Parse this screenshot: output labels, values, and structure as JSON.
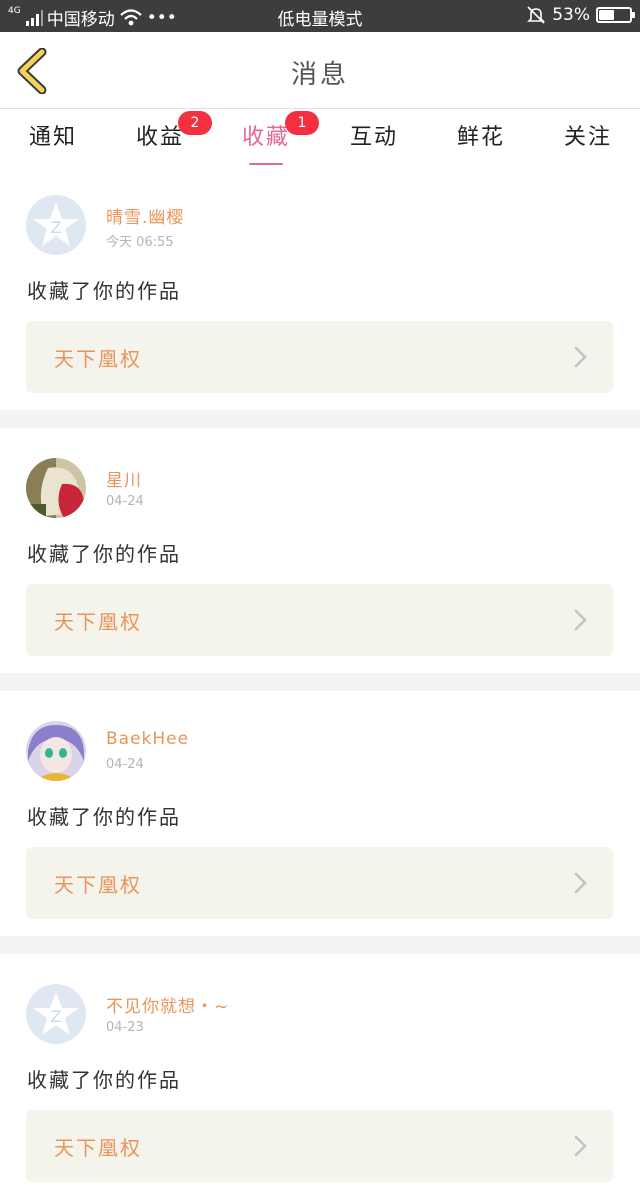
{
  "status_bar": {
    "network_type": "4G",
    "carrier": "中国移动",
    "more": "•••",
    "mode": "低电量模式",
    "battery_percent": "53%",
    "battery_level": 0.53
  },
  "nav": {
    "title": "消息"
  },
  "tabs": [
    {
      "label": "通知",
      "badge": ""
    },
    {
      "label": "收益",
      "badge": "2"
    },
    {
      "label": "收藏",
      "badge": "1"
    },
    {
      "label": "互动",
      "badge": ""
    },
    {
      "label": "鲜花",
      "badge": ""
    },
    {
      "label": "关注",
      "badge": ""
    }
  ],
  "active_tab": "收藏",
  "colors": {
    "accent": "#e5678f",
    "name_orange": "#e9955a",
    "badge_red": "#f2303f",
    "back_arrow": "#f3d35a"
  },
  "messages": [
    {
      "name": "晴雪.幽樱",
      "time": "今天 06:55",
      "text": "收藏了你的作品",
      "work": "天下凰权",
      "avatar": "default-qq-avatar"
    },
    {
      "name": "星川",
      "time": "04-24",
      "text": "收藏了你的作品",
      "work": "天下凰权",
      "avatar": "photo-avatar"
    },
    {
      "name": "BaekHee",
      "time": "04-24",
      "text": "收藏了你的作品",
      "work": "天下凰权",
      "avatar": "anime-avatar"
    },
    {
      "name": "不见你就想・~",
      "time": "04-23",
      "text": "收藏了你的作品",
      "work": "天下凰权",
      "avatar": "default-qq-avatar"
    }
  ]
}
